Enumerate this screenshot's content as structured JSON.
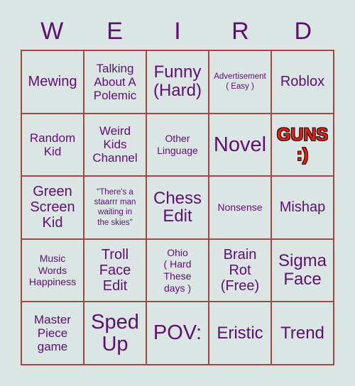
{
  "card": {
    "header_letters": [
      "W",
      "E",
      "I",
      "R",
      "D"
    ],
    "colors": {
      "background": "#dae5e4",
      "grid_line": "#9e4a42",
      "text": "#5d0f72",
      "highlight_text": "#f01b0e",
      "highlight_outline": "#111111"
    },
    "rows": [
      [
        {
          "text": "Mewing",
          "size": "lg"
        },
        {
          "text": "Talking\nAbout A\nPolemic",
          "size": "md"
        },
        {
          "text": "Funny\n(Hard)",
          "size": "xl"
        },
        {
          "text": "Advertisement\n( Easy )",
          "size": "xs"
        },
        {
          "text": "Roblox",
          "size": "lg"
        }
      ],
      [
        {
          "text": "Random\nKid",
          "size": "md"
        },
        {
          "text": "Weird\nKids\nChannel",
          "size": "md"
        },
        {
          "text": "Other\nLinguage",
          "size": "sm"
        },
        {
          "text": "Novel",
          "size": "xxl"
        },
        {
          "text": "GUNS\n:)",
          "size": "guns"
        }
      ],
      [
        {
          "text": "Green\nScreen\nKid",
          "size": "lg"
        },
        {
          "text": "\"There's a\nstaarrr man\nwaiting in\nthe skies\"",
          "size": "xs"
        },
        {
          "text": "Chess\nEdit",
          "size": "xl"
        },
        {
          "text": "Nonsense",
          "size": "sm"
        },
        {
          "text": "Mishap",
          "size": "lg"
        }
      ],
      [
        {
          "text": "Music\nWords\nHappiness",
          "size": "sm"
        },
        {
          "text": "Troll\nFace\nEdit",
          "size": "lg"
        },
        {
          "text": "Ohio\n( Hard\nThese\ndays )",
          "size": "sm"
        },
        {
          "text": "Brain\nRot\n(Free)",
          "size": "lg"
        },
        {
          "text": "Sigma\nFace",
          "size": "xl"
        }
      ],
      [
        {
          "text": "Master\nPiece\ngame",
          "size": "md"
        },
        {
          "text": "Sped\nUp",
          "size": "xxl"
        },
        {
          "text": "POV:",
          "size": "xxl"
        },
        {
          "text": "Eristic",
          "size": "xl"
        },
        {
          "text": "Trend",
          "size": "xl"
        }
      ]
    ]
  }
}
